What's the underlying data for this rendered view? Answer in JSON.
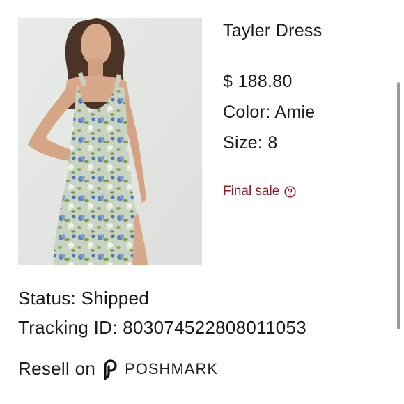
{
  "product": {
    "image_alt": "woman-in-floral-dress-photo",
    "title": "Tayler Dress",
    "price": "$ 188.80",
    "color": "Color: Amie",
    "size": "Size: 8"
  },
  "final_sale": {
    "label": "Final sale",
    "color": "#8b1c24",
    "icon": "question-circle-icon"
  },
  "order": {
    "status": "Status: Shipped",
    "tracking": "Tracking ID: 803074522808011053"
  },
  "resell": {
    "label": "Resell on",
    "brand": "POSHMARK",
    "icon": "poshmark-logo-icon"
  }
}
